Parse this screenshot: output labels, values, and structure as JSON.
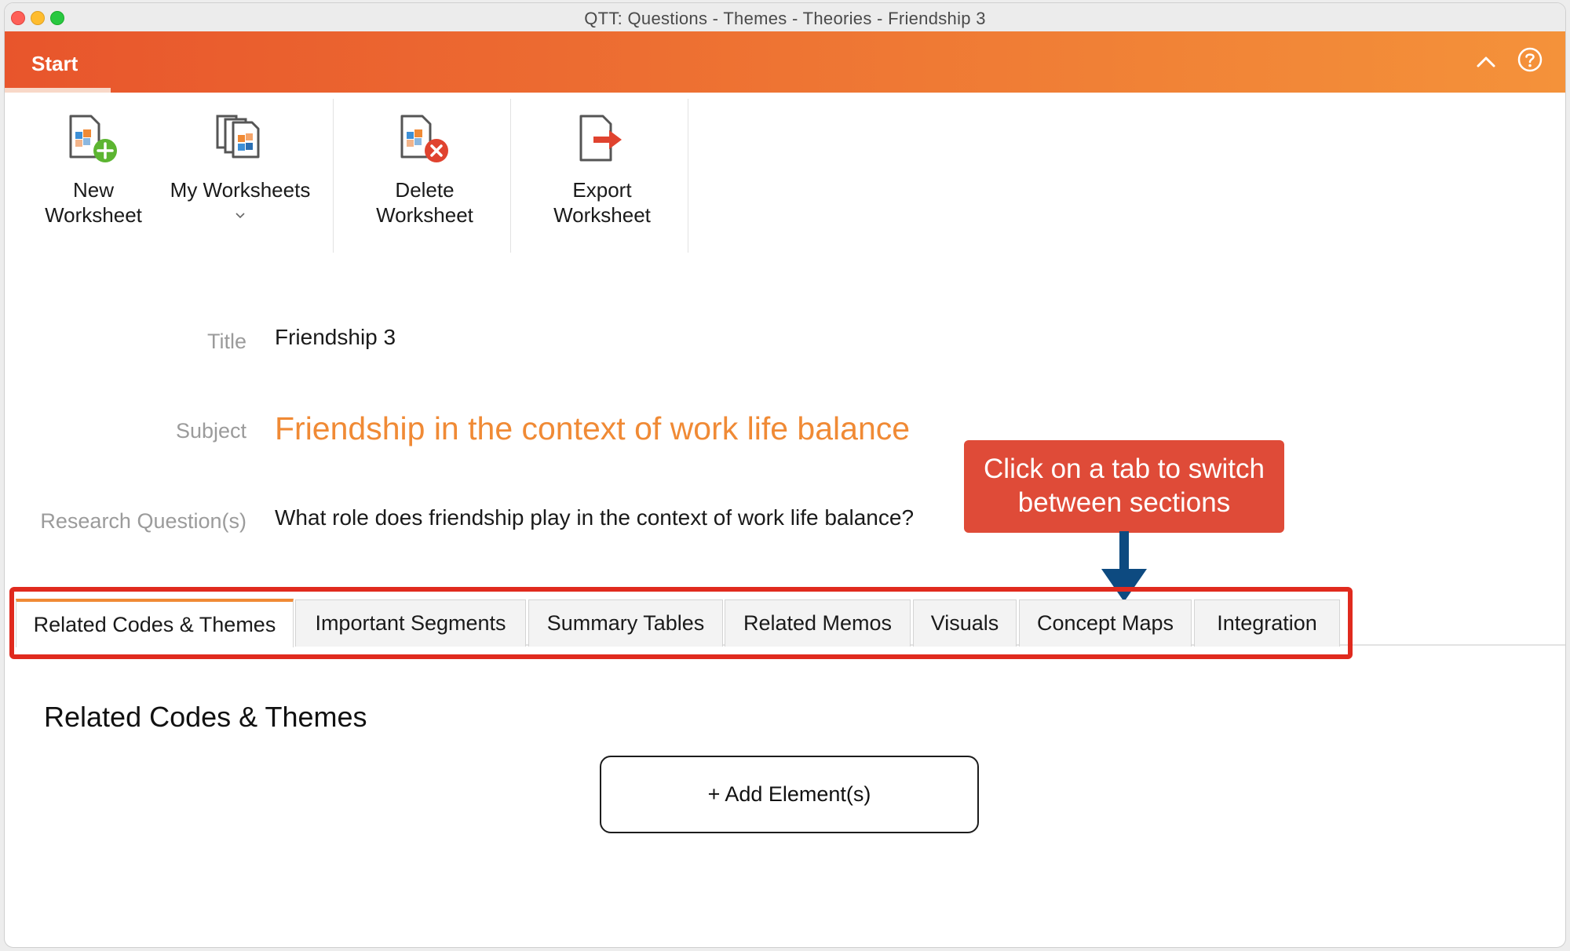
{
  "window": {
    "title": "QTT: Questions - Themes - Theories - Friendship 3"
  },
  "ribbon": {
    "active_tab": "Start"
  },
  "toolbar": {
    "new_worksheet": "New\nWorksheet",
    "my_worksheets": "My Worksheets",
    "delete_worksheet": "Delete\nWorksheet",
    "export_worksheet": "Export\nWorksheet"
  },
  "form": {
    "title_label": "Title",
    "title_value": "Friendship 3",
    "subject_label": "Subject",
    "subject_value": "Friendship in the context of work life balance",
    "rq_label": "Research Question(s)",
    "rq_value": "What role does friendship play in the context of work life balance?"
  },
  "callout": {
    "text": "Click on a tab to switch between sections"
  },
  "tabs": [
    {
      "label": "Related Codes & Themes",
      "active": true
    },
    {
      "label": "Important Segments"
    },
    {
      "label": "Summary Tables"
    },
    {
      "label": "Related Memos"
    },
    {
      "label": "Visuals"
    },
    {
      "label": "Concept Maps"
    },
    {
      "label": "Integration"
    }
  ],
  "section": {
    "title": "Related Codes & Themes",
    "add_button": "+ Add Element(s)"
  },
  "colors": {
    "accent": "#f08a35",
    "ribbon_start": "#e8552c",
    "ribbon_end": "#f4923a",
    "callout": "#df4b38",
    "highlight_border": "#e02a1e",
    "arrow": "#0d4a80"
  }
}
